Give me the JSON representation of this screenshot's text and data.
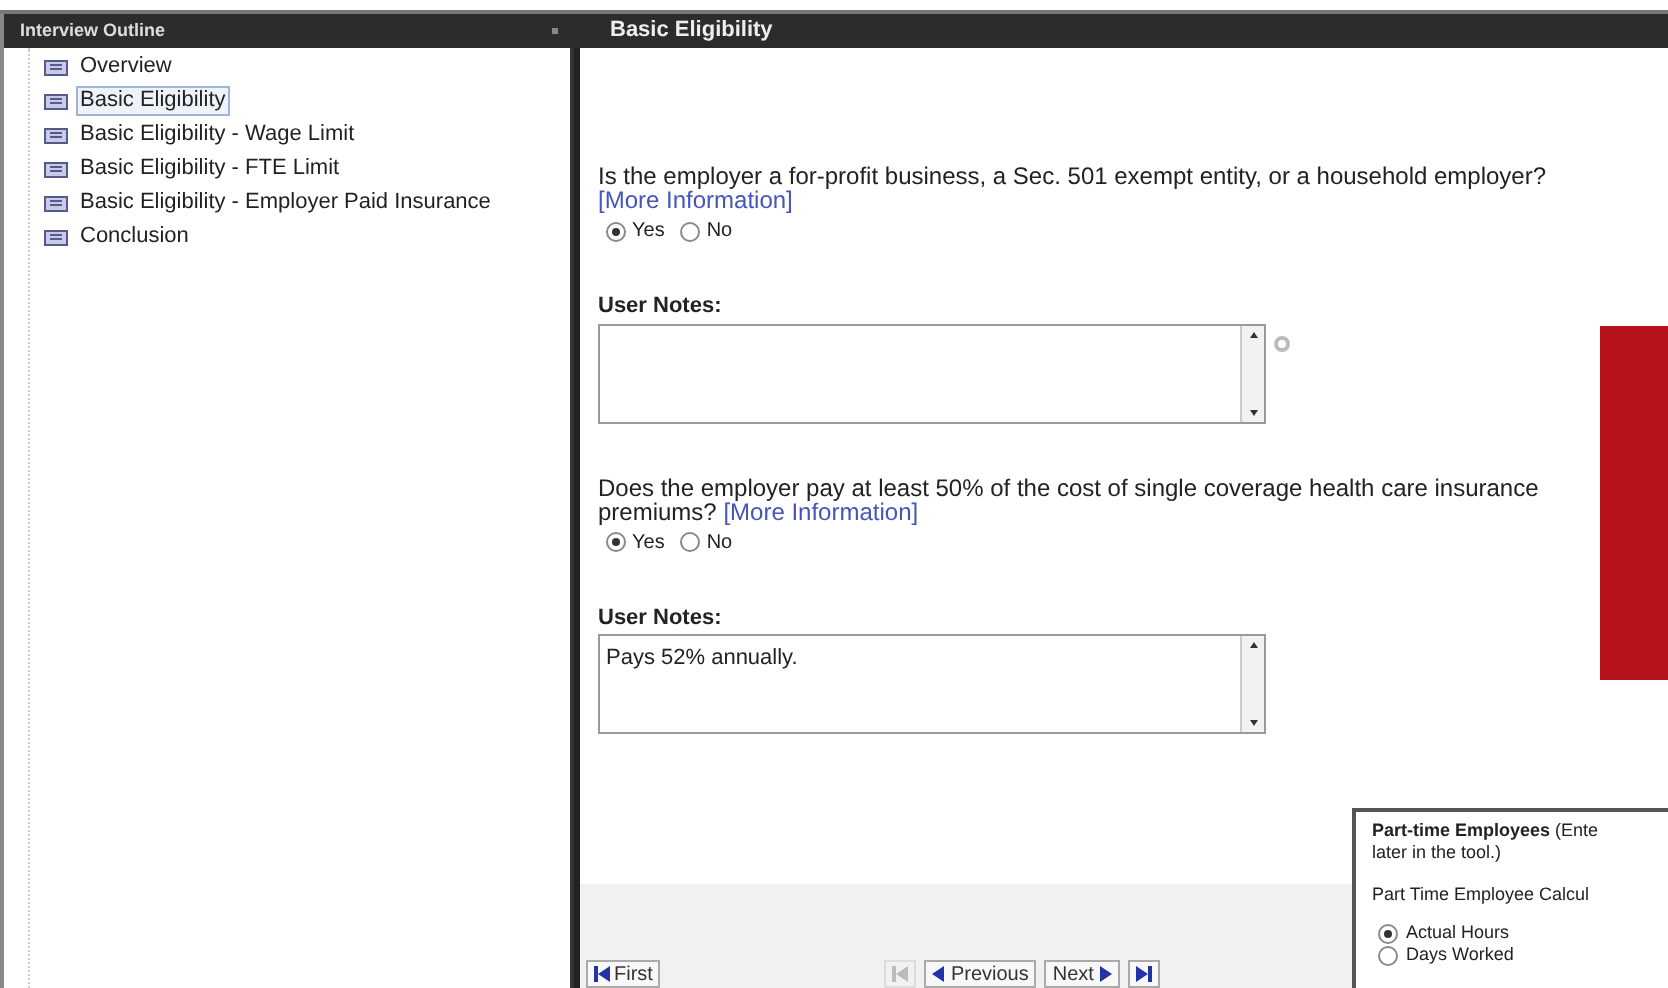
{
  "outline": {
    "title": "Interview Outline",
    "items": [
      {
        "label": "Overview",
        "selected": false
      },
      {
        "label": "Basic Eligibility",
        "selected": true
      },
      {
        "label": "Basic Eligibility - Wage Limit",
        "selected": false
      },
      {
        "label": "Basic Eligibility - FTE Limit",
        "selected": false
      },
      {
        "label": "Basic Eligibility - Employer Paid Insurance",
        "selected": false
      },
      {
        "label": "Conclusion",
        "selected": false
      }
    ]
  },
  "main": {
    "title": "Basic Eligibility",
    "questions": [
      {
        "text": "Is the employer a for-profit business, a Sec. 501 exempt entity, or a household employer?",
        "link": "[More Information]",
        "kind": "link-below",
        "options": [
          {
            "label": "Yes",
            "selected": true
          },
          {
            "label": "No",
            "selected": false
          }
        ],
        "notes_label": "User Notes:",
        "help": true
      },
      {
        "text": "Does the employer pay at least 50% of the cost of single coverage health care insurance premiums?",
        "link": "[More Information]",
        "kind": "link-inline",
        "options": [
          {
            "label": "Yes",
            "selected": true
          },
          {
            "label": "No",
            "selected": false
          }
        ],
        "notes_label": "User Notes:",
        "notes_value": "Pays 52% annually.",
        "help": false
      }
    ],
    "nav": {
      "first": "First",
      "previous": "Previous",
      "next": "Next"
    }
  },
  "popup": {
    "heading_bold": "Part-time Employees",
    "heading_rest": " (Ente",
    "heading_line2": "later in the tool.)",
    "calc_label": "Part Time Employee Calcul",
    "options": [
      {
        "label": "Actual Hours",
        "selected": true
      },
      {
        "label": "Days Worked",
        "selected": false
      }
    ]
  }
}
